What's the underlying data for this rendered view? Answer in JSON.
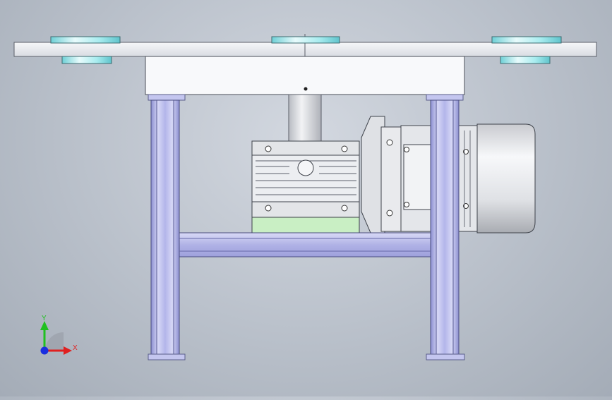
{
  "viewport": {
    "background_top": "#d3d8e0",
    "background_bottom": "#a4acb7"
  },
  "model": {
    "frame_color": "#b6b8e6",
    "plate_color": "#eef0f4",
    "flange_color": "#9fe6ea",
    "gearbox_base_color": "#c9efc4",
    "motor_color": "#e8e9ec"
  },
  "triad": {
    "x_label": "X",
    "y_label": "Y",
    "x_color": "#e02020",
    "y_color": "#20c020",
    "z_color": "#1a2ee0"
  }
}
